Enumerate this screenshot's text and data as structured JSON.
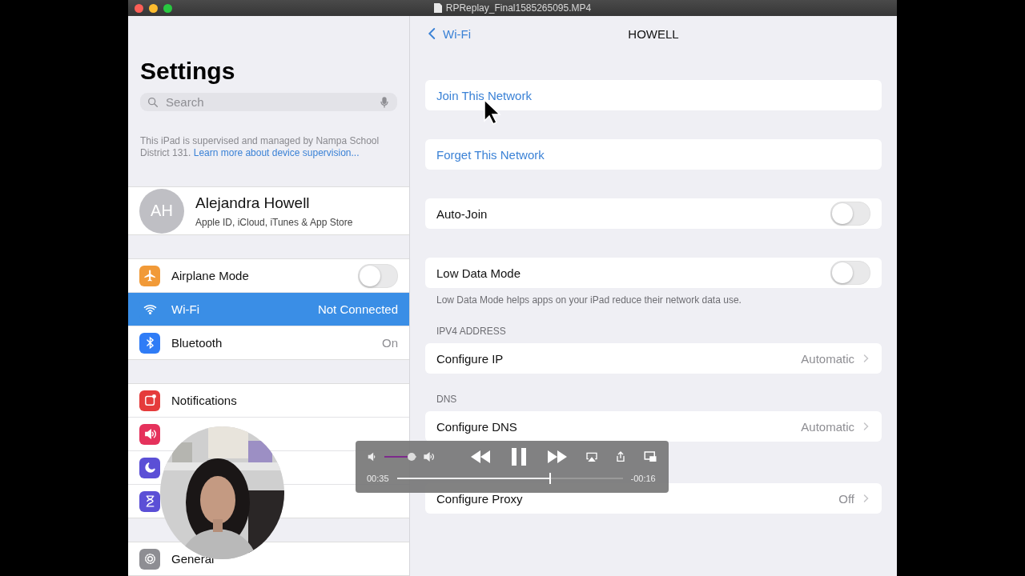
{
  "window": {
    "title": "RPReplay_Final1585265095.MP4"
  },
  "sidebar": {
    "title": "Settings",
    "search": {
      "placeholder": "Search"
    },
    "supervision": {
      "text": "This iPad is supervised and managed by Nampa School District 131.",
      "link": "Learn more about device supervision..."
    },
    "profile": {
      "initials": "AH",
      "name": "Alejandra Howell",
      "subtitle": "Apple ID, iCloud, iTunes & App Store"
    },
    "groups": [
      [
        {
          "kind": "airplane",
          "label": "Airplane Mode",
          "toggle": false,
          "selected": false
        },
        {
          "kind": "wifi",
          "label": "Wi-Fi",
          "value": "Not Connected",
          "selected": true
        },
        {
          "kind": "bluetooth",
          "label": "Bluetooth",
          "value": "On",
          "selected": false
        }
      ],
      [
        {
          "kind": "notifications",
          "label": "Notifications",
          "selected": false
        },
        {
          "kind": "sounds",
          "selected": false
        },
        {
          "kind": "moon",
          "selected": false
        },
        {
          "kind": "hourglass",
          "selected": false
        }
      ],
      [
        {
          "kind": "general",
          "label": "General",
          "selected": false
        }
      ]
    ]
  },
  "detail": {
    "back": "Wi-Fi",
    "title": "HOWELL",
    "sections": [
      {
        "rows": [
          {
            "kind": "action",
            "label": "Join This Network"
          }
        ]
      },
      {
        "rows": [
          {
            "kind": "action",
            "label": "Forget This Network"
          }
        ]
      },
      {
        "rows": [
          {
            "kind": "toggle",
            "label": "Auto-Join",
            "on": false
          }
        ]
      },
      {
        "rows": [
          {
            "kind": "toggle",
            "label": "Low Data Mode",
            "on": false
          }
        ],
        "footer": "Low Data Mode helps apps on your iPad reduce their network data use."
      },
      {
        "header": "IPV4 ADDRESS",
        "rows": [
          {
            "kind": "link",
            "label": "Configure IP",
            "value": "Automatic"
          }
        ]
      },
      {
        "header": "DNS",
        "rows": [
          {
            "kind": "link",
            "label": "Configure DNS",
            "value": "Automatic"
          }
        ]
      },
      {
        "rows": [
          {
            "kind": "link",
            "label": "Configure Proxy",
            "value": "Off"
          }
        ]
      }
    ]
  },
  "player": {
    "volume": {
      "level": 0.85
    },
    "elapsed": "00:35",
    "progress": {
      "level": 0.68
    },
    "remaining": "-00:16"
  }
}
